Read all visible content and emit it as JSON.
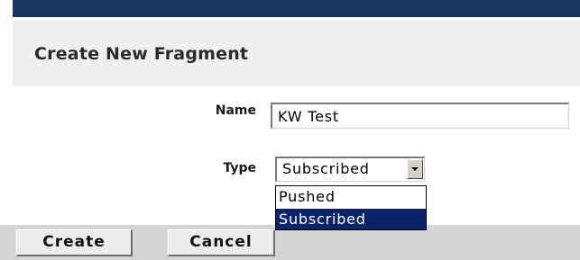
{
  "page": {
    "title": "Create New Fragment"
  },
  "form": {
    "name_label": "Name",
    "name_value": "KW Test",
    "type_label": "Type",
    "type_selected": "Subscribed",
    "type_options": [
      "Pushed",
      "Subscribed"
    ],
    "type_highlighted_index": 1
  },
  "buttons": {
    "create_label": "Create",
    "cancel_label": "Cancel"
  },
  "colors": {
    "header_bar": "#17375f",
    "title_panel": "#efefef",
    "footer_bar": "#d4d4d4",
    "selection_highlight": "#0a246a"
  }
}
